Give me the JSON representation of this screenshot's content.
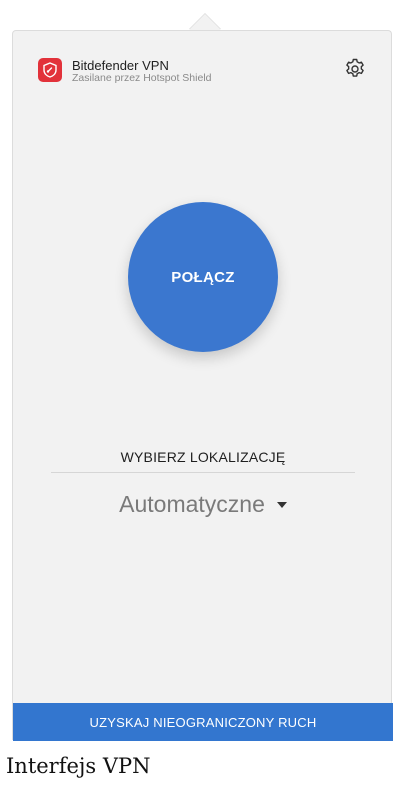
{
  "header": {
    "app_title": "Bitdefender VPN",
    "app_subtitle": "Zasilane przez Hotspot Shield",
    "logo_icon": "bitdefender-logo-icon",
    "settings_icon": "gear-icon"
  },
  "connect": {
    "label": "POŁĄCZ"
  },
  "location": {
    "label": "WYBIERZ LOKALIZACJĘ",
    "selected": "Automatyczne"
  },
  "upgrade": {
    "label": "UZYSKAJ NIEOGRANICZONY RUCH"
  },
  "caption": "Interfejs VPN",
  "colors": {
    "accent": "#3b77cf",
    "logo": "#e2323a",
    "background": "#f2f2f2"
  }
}
